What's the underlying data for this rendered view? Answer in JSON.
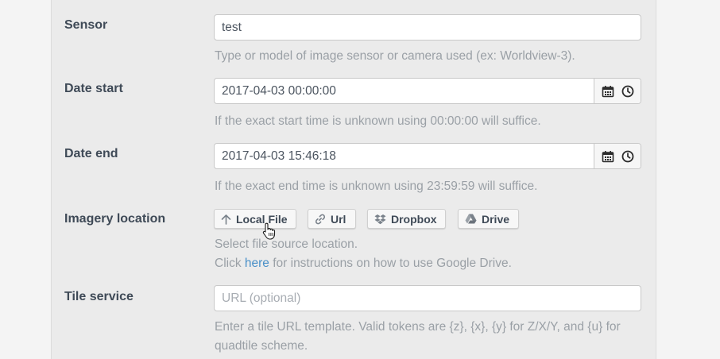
{
  "fields": {
    "sensor": {
      "label": "Sensor",
      "value": "test",
      "help": "Type or model of image sensor or camera used (ex: Worldview-3)."
    },
    "date_start": {
      "label": "Date start",
      "value": "2017-04-03 00:00:00",
      "help": "If the exact start time is unknown using 00:00:00 will suffice."
    },
    "date_end": {
      "label": "Date end",
      "value": "2017-04-03 15:46:18",
      "help": "If the exact end time is unknown using 23:59:59 will suffice."
    },
    "imagery_location": {
      "label": "Imagery location",
      "buttons": {
        "local_file": "Local File",
        "url": "Url",
        "dropbox": "Dropbox",
        "drive": "Drive"
      },
      "help_line1": "Select file source location.",
      "help_line2_pre": "Click ",
      "help_link": "here",
      "help_line2_post": " for instructions on how to use Google Drive."
    },
    "tile_service": {
      "label": "Tile service",
      "placeholder": "URL (optional)",
      "help_line1": "Enter a tile URL template. Valid tokens are {z}, {x}, {y} for Z/X/Y, and {u} for",
      "help_line2": "quadtile scheme."
    }
  },
  "colors": {
    "label": "#3f4a57",
    "help": "#9aa0a6",
    "link": "#4a90c8"
  }
}
